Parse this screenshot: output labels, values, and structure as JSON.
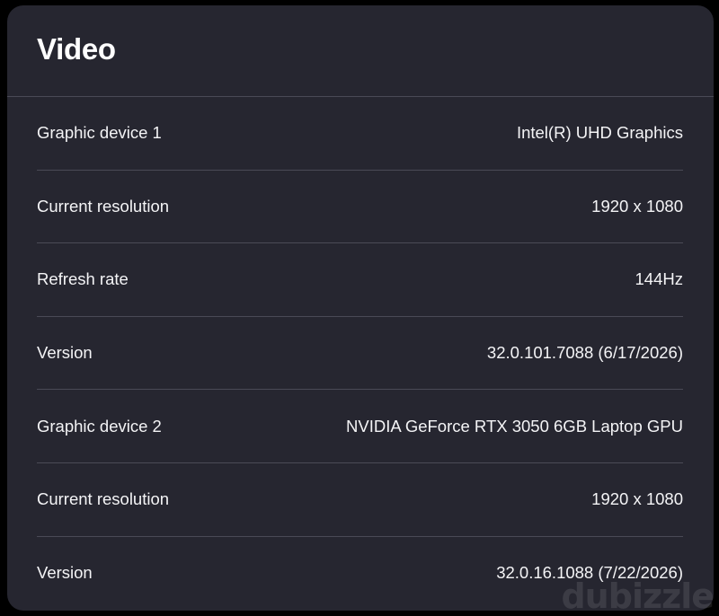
{
  "panel": {
    "title": "Video",
    "rows": [
      {
        "label": "Graphic device 1",
        "value": "Intel(R) UHD Graphics"
      },
      {
        "label": "Current resolution",
        "value": "1920 x 1080"
      },
      {
        "label": "Refresh rate",
        "value": "144Hz"
      },
      {
        "label": "Version",
        "value": "32.0.101.7088 (6/17/2026)"
      },
      {
        "label": "Graphic device 2",
        "value": "NVIDIA GeForce RTX 3050 6GB Laptop GPU"
      },
      {
        "label": "Current resolution",
        "value": "1920 x 1080"
      },
      {
        "label": "Version",
        "value": "32.0.16.1088 (7/22/2026)"
      }
    ]
  },
  "watermark": "dubizzle",
  "colors": {
    "page_background": "#000000",
    "panel_background": "#262630",
    "divider": "#4a4a56",
    "text": "#f2f2f4"
  }
}
